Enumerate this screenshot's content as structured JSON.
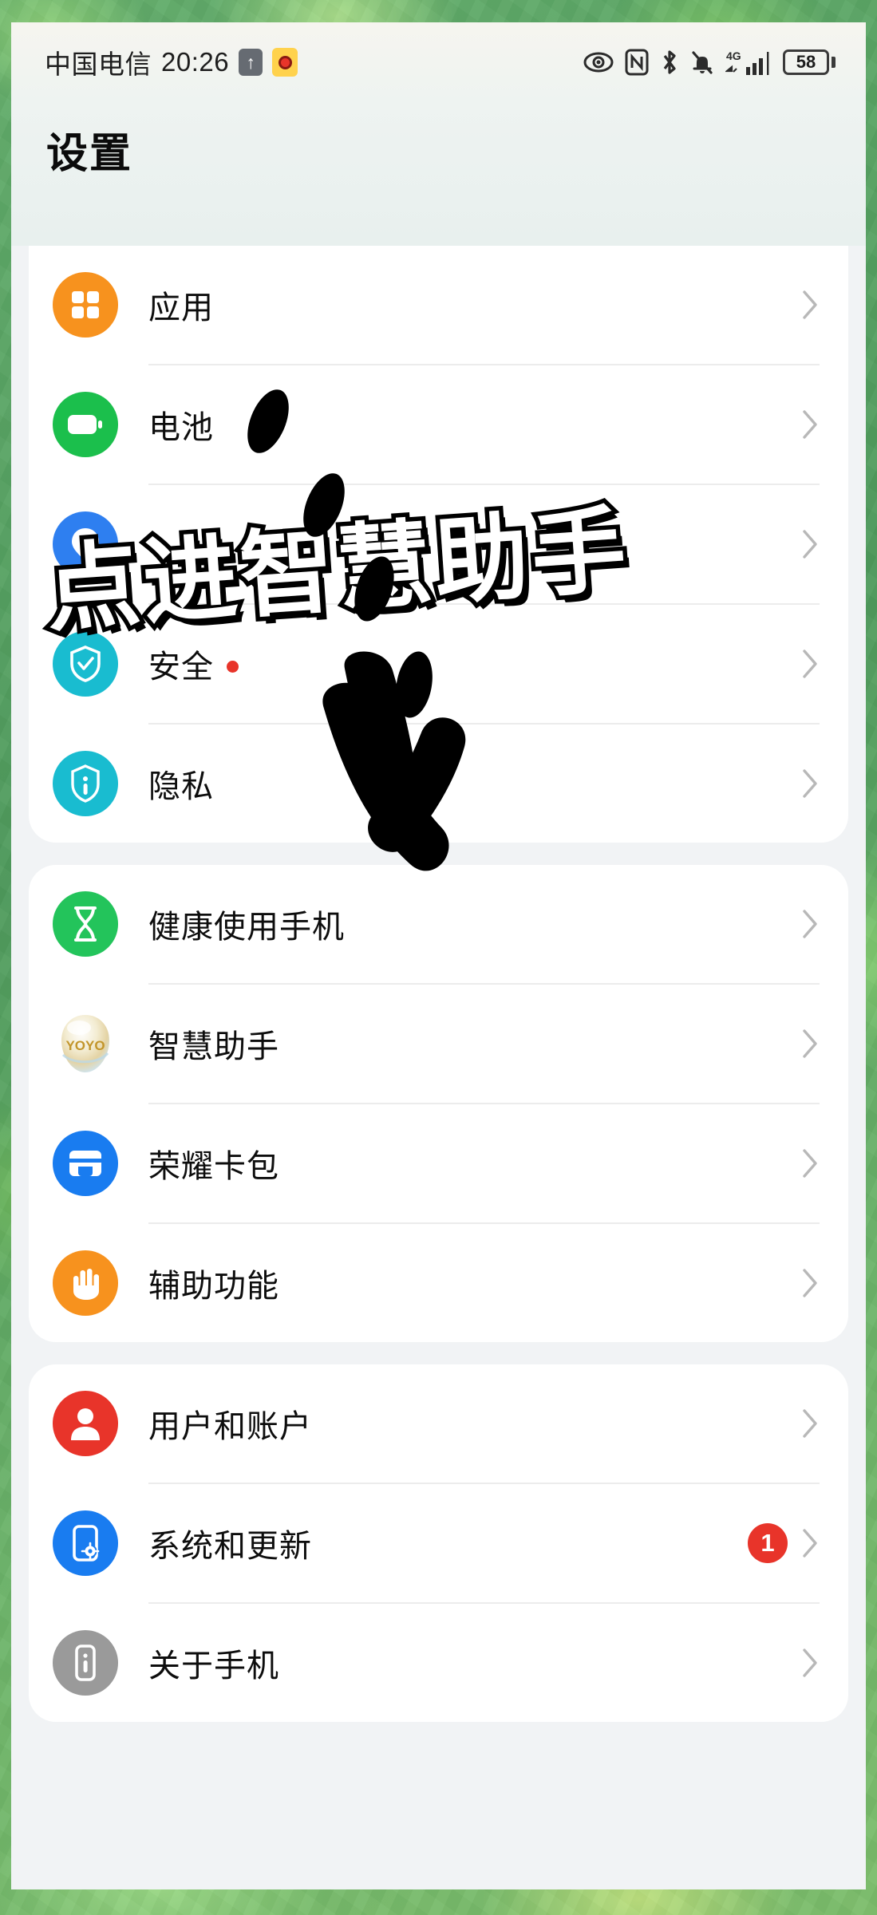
{
  "status_bar": {
    "carrier": "中国电信",
    "time": "20:26",
    "upload_icon": "upload-arrow-icon",
    "app_icon": "weibo-icon",
    "right_icons": [
      "eye-comfort-icon",
      "nfc-icon",
      "bluetooth-icon",
      "mute-bell-icon",
      "signal-4g-icon"
    ],
    "network_label": "4G",
    "battery_percent": "58"
  },
  "header": {
    "title": "设置"
  },
  "annotation": {
    "text": "点进智慧助手",
    "arrow": "hand-drawn-dashed-arrow"
  },
  "colors": {
    "apps": "#F7921E",
    "battery": "#1BBF4C",
    "location": "#2E7FF0",
    "security": "#19BCD0",
    "privacy": "#19BCD0",
    "digital_balance": "#23C45B",
    "assistant": "#EDE2C0",
    "wallet": "#197CF0",
    "accessibility": "#F7921E",
    "users": "#E8342A",
    "system": "#197CF0",
    "about": "#9A9A9A",
    "badge_red": "#E8342A",
    "dot_red": "#E8342A"
  },
  "groups": [
    {
      "id": "group-1",
      "clipped_top": true,
      "items": [
        {
          "label": "应用",
          "icon": "apps-grid-icon",
          "color_key": "apps",
          "dot": false,
          "badge": null,
          "chevron": true
        },
        {
          "label": "电池",
          "icon": "battery-icon",
          "color_key": "battery",
          "dot": false,
          "badge": null,
          "chevron": true
        },
        {
          "label": "",
          "icon": "location-icon",
          "color_key": "location",
          "dot": false,
          "badge": null,
          "chevron": true,
          "obscured_by_annotation": true
        },
        {
          "label": "安全",
          "icon": "shield-check-icon",
          "color_key": "security",
          "dot": true,
          "badge": null,
          "chevron": true
        },
        {
          "label": "隐私",
          "icon": "lock-info-icon",
          "color_key": "privacy",
          "dot": false,
          "badge": null,
          "chevron": true
        }
      ]
    },
    {
      "id": "group-2",
      "clipped_top": false,
      "items": [
        {
          "label": "健康使用手机",
          "icon": "hourglass-icon",
          "color_key": "digital_balance",
          "dot": false,
          "badge": null,
          "chevron": true
        },
        {
          "label": "智慧助手",
          "icon": "yoyo-orb-icon",
          "color_key": "assistant",
          "dot": false,
          "badge": null,
          "chevron": true
        },
        {
          "label": "荣耀卡包",
          "icon": "wallet-card-icon",
          "color_key": "wallet",
          "dot": false,
          "badge": null,
          "chevron": true
        },
        {
          "label": "辅助功能",
          "icon": "hand-icon",
          "color_key": "accessibility",
          "dot": false,
          "badge": null,
          "chevron": true
        }
      ]
    },
    {
      "id": "group-3",
      "clipped_top": false,
      "items": [
        {
          "label": "用户和账户",
          "icon": "user-icon",
          "color_key": "users",
          "dot": false,
          "badge": null,
          "chevron": true
        },
        {
          "label": "系统和更新",
          "icon": "phone-gear-icon",
          "color_key": "system",
          "dot": false,
          "badge": "1",
          "chevron": true
        },
        {
          "label": "关于手机",
          "icon": "phone-info-icon",
          "color_key": "about",
          "dot": false,
          "badge": null,
          "chevron": true
        }
      ]
    }
  ]
}
